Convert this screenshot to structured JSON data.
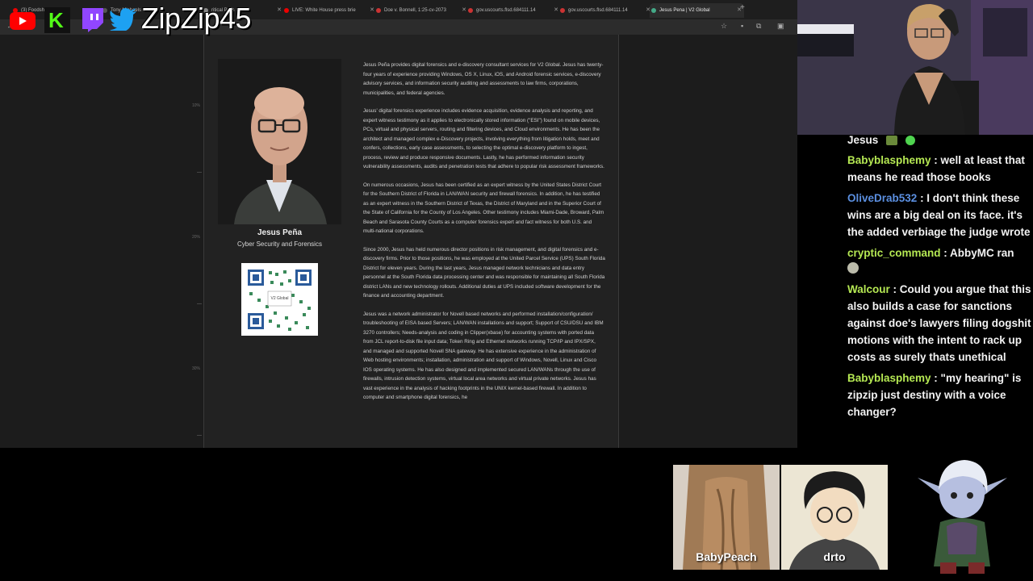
{
  "browser": {
    "tabs": [
      {
        "label": "(3) Foodshi",
        "favicon": "#e00"
      },
      {
        "label": "Tony Michaels",
        "favicon": "#444"
      },
      {
        "label": "ritical Polls ×",
        "favicon": "#888"
      },
      {
        "label": "LIVE: White House press brie",
        "favicon": "#e00"
      },
      {
        "label": "Doe v. Bonnell, 1:25-cv-2073",
        "favicon": "#c33"
      },
      {
        "label": "gov.uscourts.flsd.684111.14",
        "favicon": "#c33"
      },
      {
        "label": "gov.uscourts.flsd.684111.14",
        "favicon": "#c33"
      },
      {
        "label": "Jesus Pena | V2 Global",
        "favicon": "#4a8"
      }
    ],
    "new_tab": "+",
    "zoom_marks": [
      "10%",
      "20%",
      "30%"
    ]
  },
  "document": {
    "name": "Jesus Peña",
    "role": "Cyber Security and Forensics",
    "qr_label": "V2 Global",
    "paragraphs": [
      "Jesus Peña provides digital forensics and e-discovery consultant services for V2 Global. Jesus has twenty-four years of experience providing Windows, OS X, Linux, iOS, and Android forensic services, e-discovery advisory services, and information security auditing and assessments to law firms, corporations, municipalities, and federal agencies.",
      "Jesus' digital forensics experience includes evidence acquisition, evidence analysis and reporting, and expert witness testimony as it applies to electronically stored information (\"ESI\") found on mobile devices, PCs, virtual and physical servers, routing and filtering devices, and Cloud environments. He has been the architect and managed complex e-Discovery projects, involving everything from litigation holds, meet and confers, collections, early case assessments, to selecting the optimal e-discovery platform to ingest, process, review and produce responsive documents. Lastly, he has performed information security vulnerability assessments, audits and penetration tests that adhere to popular risk assessment frameworks.",
      "On numerous occasions, Jesus has been certified as an expert witness by the United States District Court for the Southern District of Florida in LAN/WAN security and firewall forensics. In addition, he has testified as an expert witness in the Southern District of Texas, the District of Maryland and in the Superior Court of the State of California for the County of Los Angeles. Other testimony includes Miami-Dade, Broward, Palm Beach and Sarasota County Courts as a computer forensics expert and fact witness for both U.S. and multi-national corporations.",
      "Since 2000, Jesus has held numerous director positions in risk management, and digital forensics and e-discovery firms. Prior to those positions, he was employed at the United Parcel Service (UPS) South Florida District for eleven years. During the last years, Jesus managed network technicians and data entry personnel at the South Florida data processing center and was responsible for maintaining all South Florida district LANs and new technology rollouts. Additional duties at UPS included software development for the finance and accounting department.",
      "Jesus was a network administrator for Novell based networks and performed installation/configuration/ troubleshooting of EISA based Servers; LAN/WAN installations and support; Support of CSU/DSU and IBM 3270 controllers; Needs-analysis and coding in Clipper(xbase) for accounting systems with ported data from JCL report-to-disk file input data; Token Ring and Ethernet networks running TCP/IP and IPX/SPX, and managed and supported Novell SNA gateway. He has extensive experience in the administration of Web hosting environments; installation, administration and support of Windows, Novell, Linux and Cisco IOS operating systems. He has also designed and implemented secured LAN/WANs through the use of firewalls, intrusion detection systems, virtual local area networks and virtual private networks. Jesus has vast experience in the analysis of hacking footprints in the UNIX kernel-based firewall. In addition to computer and smartphone digital forensics, he"
    ]
  },
  "overlay": {
    "handle": "ZipZip45",
    "social_icons": [
      "youtube-icon",
      "kick-icon",
      "twitch-icon",
      "twitter-icon"
    ]
  },
  "chat": {
    "top_fragment": "Jesus",
    "messages": [
      {
        "user": "Babyblasphemy",
        "color": "green",
        "text": " : well at least that means he read those books"
      },
      {
        "user": "OliveDrab532",
        "color": "blue",
        "text": " : I don't think these wins are a big deal on its face. it's the added verbiage the judge wrote"
      },
      {
        "user": "cryptic_command",
        "color": "green",
        "text": " : AbbyMC ran"
      },
      {
        "user": "Walcour",
        "color": "green",
        "text": " : Could you argue that this also builds a case for sanctions against doe's lawyers filing dogshit motions with the intent to rack up costs as surely thats unethical"
      },
      {
        "user": "Babyblasphemy",
        "color": "green",
        "text": " : \"my hearing\" is zipzip just destiny with a voice changer?"
      }
    ]
  },
  "guests": [
    {
      "name": "BabyPeach"
    },
    {
      "name": "drto"
    }
  ]
}
